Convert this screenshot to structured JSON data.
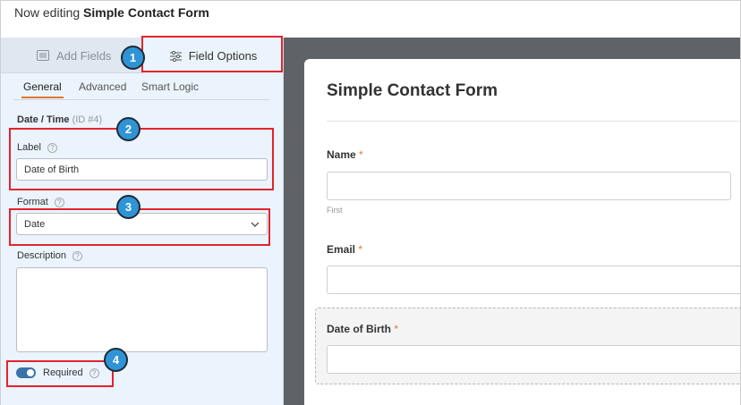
{
  "header": {
    "prefix": "Now editing",
    "form_name": "Simple Contact Form"
  },
  "panel_tabs": {
    "add_fields": {
      "label": "Add Fields",
      "icon": "list-icon"
    },
    "field_options": {
      "label": "Field Options",
      "icon": "sliders-icon",
      "active": true
    }
  },
  "sub_tabs": [
    "General",
    "Advanced",
    "Smart Logic"
  ],
  "field": {
    "type_label": "Date / Time",
    "id_text": "(ID #4)",
    "label_title": "Label",
    "label_value": "Date of Birth",
    "format_title": "Format",
    "format_value": "Date",
    "description_title": "Description",
    "description_value": "",
    "required_label": "Required",
    "required_on": true,
    "help_glyph": "?"
  },
  "callouts": [
    "1",
    "2",
    "3",
    "4"
  ],
  "preview": {
    "title": "Simple Contact Form",
    "required_mark": "*",
    "fields": [
      {
        "label": "Name",
        "sublabel": "First"
      },
      {
        "label": "Email"
      },
      {
        "label": "Date of Birth"
      }
    ]
  },
  "colors": {
    "accent": "#e27730",
    "callout_blue": "#2f94d6",
    "highlight_red": "#e2242c",
    "toggle_on": "#3a73a9"
  }
}
